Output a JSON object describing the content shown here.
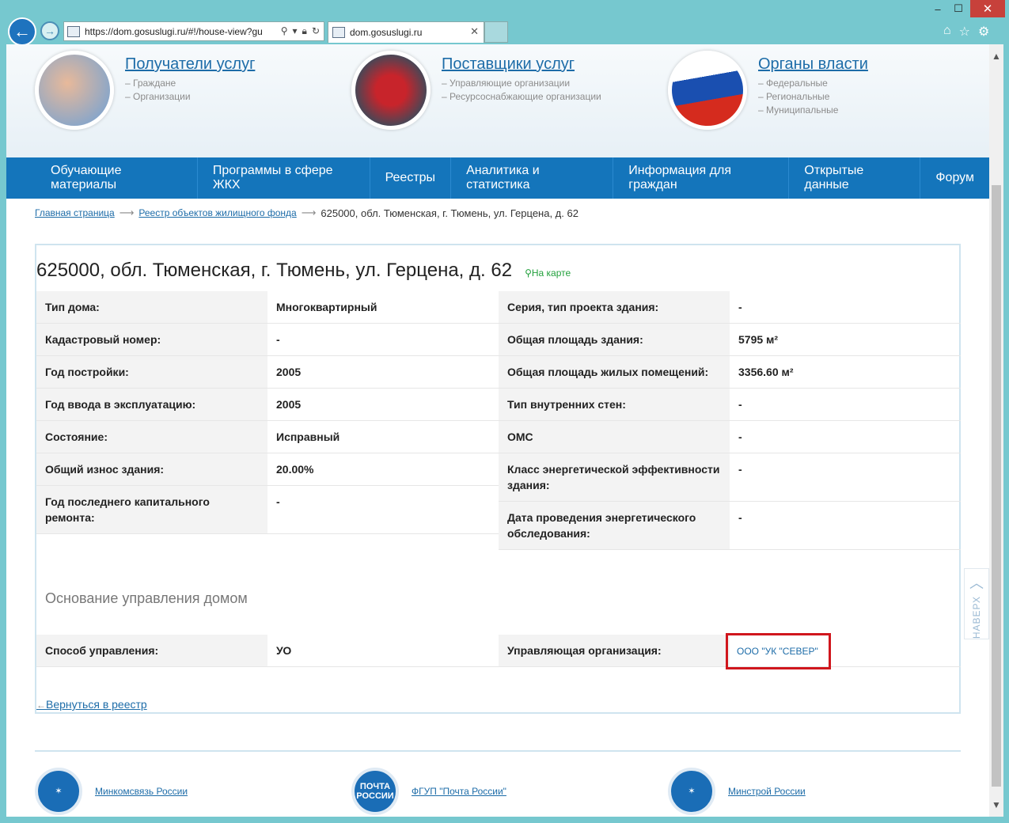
{
  "browser": {
    "url": "https://dom.gosuslugi.ru/#!/house-view?gu",
    "tab_title": "dom.gosuslugi.ru"
  },
  "hero": [
    {
      "title": "Получатели услуг",
      "subs": [
        "– Граждане",
        "– Организации"
      ]
    },
    {
      "title": "Поставщики услуг",
      "subs": [
        "– Управляющие организации",
        "– Ресурсоснабжающие организации"
      ]
    },
    {
      "title": "Органы власти",
      "subs": [
        "– Федеральные",
        "– Региональные",
        "– Муниципальные"
      ]
    }
  ],
  "menu": [
    "Обучающие материалы",
    "Программы в сфере ЖКХ",
    "Реестры",
    "Аналитика и статистика",
    "Информация для граждан",
    "Открытые данные",
    "Форум"
  ],
  "breadcrumbs": {
    "home": "Главная страница",
    "registry": "Реестр объектов жилищного фонда",
    "current": "625000, обл. Тюменская, г. Тюмень, ул. Герцена, д. 62"
  },
  "house": {
    "title": "625000, обл. Тюменская, г. Тюмень, ул. Герцена, д. 62",
    "map_link": "На карте",
    "left": [
      {
        "label": "Тип дома:",
        "value": "Многоквартирный"
      },
      {
        "label": "Кадастровый номер:",
        "value": "-"
      },
      {
        "label": "Год постройки:",
        "value": "2005"
      },
      {
        "label": "Год ввода в эксплуатацию:",
        "value": "2005"
      },
      {
        "label": "Состояние:",
        "value": "Исправный"
      },
      {
        "label": "Общий износ здания:",
        "value": "20.00%"
      },
      {
        "label": "Год последнего капитального ремонта:",
        "value": "-"
      }
    ],
    "right": [
      {
        "label": "Серия, тип проекта здания:",
        "value": "-"
      },
      {
        "label": "Общая площадь здания:",
        "value": "5795 м²"
      },
      {
        "label": "Общая площадь жилых помещений:",
        "value": "3356.60 м²"
      },
      {
        "label": "Тип внутренних стен:",
        "value": "-"
      },
      {
        "label": "ОМС",
        "value": "-"
      },
      {
        "label": "Класс энергетической эффективности здания:",
        "value": "-"
      },
      {
        "label": "Дата проведения энергетического обследования:",
        "value": "-"
      }
    ]
  },
  "management": {
    "section_title": "Основание управления домом",
    "method_label": "Способ управления:",
    "method_value": "УО",
    "org_label": "Управляющая организация:",
    "org_value": "ООО \"УК \"СЕВЕР\""
  },
  "back_link": "Вернуться в реестр",
  "to_top": "НАВЕРХ",
  "partners": [
    "Минкомсвязь России",
    "ФГУП \"Почта России\"",
    "Минстрой России"
  ],
  "partner_emblem_text": "ПОЧТА РОССИИ"
}
